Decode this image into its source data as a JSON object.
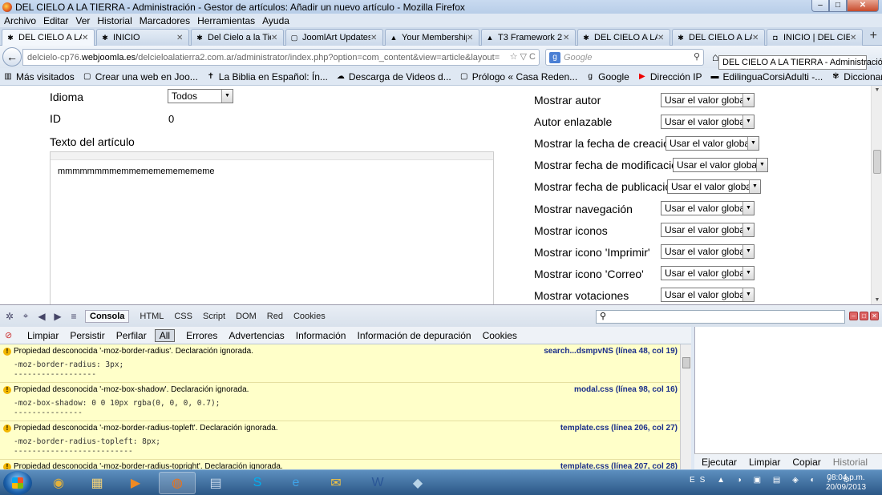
{
  "window": {
    "title": "DEL CIELO A LA TIERRA - Administración - Gestor de artículos: Añadir un nuevo artículo - Mozilla Firefox",
    "min": "–",
    "max": "□",
    "close": "✕"
  },
  "menu": [
    "Archivo",
    "Editar",
    "Ver",
    "Historial",
    "Marcadores",
    "Herramientas",
    "Ayuda"
  ],
  "tabs": [
    {
      "label": "DEL CIELO A LA TI...",
      "icon": "joomla-icon",
      "glyph": "✱",
      "active": true
    },
    {
      "label": "INICIO",
      "icon": "joomla-icon",
      "glyph": "✱",
      "active": false
    },
    {
      "label": "Del Cielo a la Tierr...",
      "icon": "joomla-icon",
      "glyph": "✱",
      "active": false
    },
    {
      "label": "JoomlArt Updates...",
      "icon": "page-icon",
      "glyph": "▢",
      "active": false
    },
    {
      "label": "Your Membership...",
      "icon": "joomlart-icon",
      "glyph": "▲",
      "active": false
    },
    {
      "label": "T3 Framework 2 f...",
      "icon": "joomlart-icon",
      "glyph": "▲",
      "active": false
    },
    {
      "label": "DEL CIELO A LA TI...",
      "icon": "joomla-icon",
      "glyph": "✱",
      "active": false
    },
    {
      "label": "DEL CIELO A LA TI...",
      "icon": "joomla-icon",
      "glyph": "✱",
      "active": false
    },
    {
      "label": "INICIO | DEL CIEL...",
      "icon": "site-icon",
      "glyph": "◘",
      "active": false
    }
  ],
  "tab_close": "✕",
  "new_tab": "+",
  "nav": {
    "back": "←",
    "url_prefix": "delcielo-cp76.",
    "url_domain": "webjoomla.es",
    "url_rest": "/delcieloalatierra2.com.ar/administrator/index.php?option=com_content&view=article&layout=",
    "url_icons": "☆ ▽ C",
    "search_engine": "g",
    "search_placeholder": "Google",
    "search_icon": "⚲",
    "home_icon": "⌂"
  },
  "tooltip": "DEL CIELO A LA TIERRA - Administración",
  "bookmarks": [
    {
      "label": "Más visitados",
      "icon": "bookmarks-icon",
      "glyph": "▥"
    },
    {
      "label": "Crear una web en Joo...",
      "icon": "page-icon",
      "glyph": "▢"
    },
    {
      "label": "La Biblia en Español: Ín...",
      "icon": "bible-icon",
      "glyph": "✝"
    },
    {
      "label": "Descarga de Videos d...",
      "icon": "download-icon",
      "glyph": "☁"
    },
    {
      "label": "Prólogo « Casa Reden...",
      "icon": "page-icon",
      "glyph": "▢"
    },
    {
      "label": "Google",
      "icon": "google-icon",
      "glyph": "g"
    },
    {
      "label": "Dirección IP",
      "icon": "youtube-icon",
      "glyph": "▶"
    },
    {
      "label": "EdilinguaCorsiAdulti -...",
      "icon": "page-icon",
      "glyph": "▬"
    },
    {
      "label": "Diccionario de la leng...",
      "icon": "dictionary-icon",
      "glyph": "✾"
    }
  ],
  "form_left": {
    "idioma_label": "Idioma",
    "idioma_value": "Todos",
    "id_label": "ID",
    "id_value": "0",
    "texto_label": "Texto del artículo",
    "editor_text": "mmmmmmmmemmememememememe"
  },
  "form_right": [
    {
      "label": "Mostrar autor",
      "value": "Usar el valor global"
    },
    {
      "label": "Autor enlazable",
      "value": "Usar el valor global"
    },
    {
      "label": "Mostrar la fecha de creación",
      "value": "Usar el valor global"
    },
    {
      "label": "Mostrar fecha de modificación",
      "value": "Usar el valor global"
    },
    {
      "label": "Mostrar fecha de publicación",
      "value": "Usar el valor global"
    },
    {
      "label": "Mostrar navegación",
      "value": "Usar el valor global"
    },
    {
      "label": "Mostrar iconos",
      "value": "Usar el valor global"
    },
    {
      "label": "Mostrar icono 'Imprimir'",
      "value": "Usar el valor global"
    },
    {
      "label": "Mostrar icono 'Correo'",
      "value": "Usar el valor global"
    },
    {
      "label": "Mostrar votaciones",
      "value": "Usar el valor global"
    }
  ],
  "select_arrow": "▼",
  "firebug": {
    "panel": "Consola",
    "panel_tabs": [
      "HTML",
      "CSS",
      "Script",
      "DOM",
      "Red",
      "Cookies"
    ],
    "filters": [
      "Limpiar",
      "Persistir",
      "Perfilar"
    ],
    "all": "All",
    "levels": [
      "Errores",
      "Advertencias",
      "Información",
      "Información de depuración",
      "Cookies"
    ],
    "search_placeholder": "⚲",
    "warn_glyph": "!",
    "logs": [
      {
        "msg": "Propiedad desconocida '-moz-border-radius'. Declaración ignorada.",
        "src": "search...dsmpvNS (línea 48, col 19)",
        "code": "-moz-border-radius: 3px;",
        "dashes": "------------------"
      },
      {
        "msg": "Propiedad desconocida '-moz-box-shadow'. Declaración ignorada.",
        "src": "modal.css (línea 98, col 16)",
        "code": "-moz-box-shadow: 0 0 10px rgba(0, 0, 0, 0.7);",
        "dashes": "---------------"
      },
      {
        "msg": "Propiedad desconocida '-moz-border-radius-topleft'. Declaración ignorada.",
        "src": "template.css (línea 206, col 27)",
        "code": "-moz-border-radius-topleft: 8px;",
        "dashes": "--------------------------"
      },
      {
        "msg": "Propiedad desconocida '-moz-border-radius-topright'. Declaración ignorada.",
        "src": "template.css (línea 207, col 28)",
        "code": "",
        "dashes": ""
      }
    ],
    "right_actions": [
      "Ejecutar",
      "Limpiar",
      "Copiar"
    ],
    "right_disabled": "Historial"
  },
  "taskbar": {
    "lang": "ES",
    "tray_icons": "▲ ◑ ▣ ▤ ◈ ◐ ♪ ⚙",
    "time": "08:04 p.m.",
    "date": "20/09/2013",
    "apps": [
      {
        "name": "chrome-app",
        "glyph": "◉",
        "color": "#e2b13c",
        "open": false
      },
      {
        "name": "explorer-app",
        "glyph": "▦",
        "color": "#f2d27a",
        "open": false
      },
      {
        "name": "media-player-app",
        "glyph": "▶",
        "color": "#f08a24",
        "open": false
      },
      {
        "name": "firefox-app",
        "glyph": "◍",
        "color": "#e8731c",
        "open": true
      },
      {
        "name": "calculator-app",
        "glyph": "▤",
        "color": "#c8d8ea",
        "open": false
      },
      {
        "name": "skype-app",
        "glyph": "S",
        "color": "#00aff0",
        "open": false
      },
      {
        "name": "ie-app",
        "glyph": "e",
        "color": "#3fa3e8",
        "open": false
      },
      {
        "name": "mail-app",
        "glyph": "✉",
        "color": "#f5c542",
        "open": false
      },
      {
        "name": "word-app",
        "glyph": "W",
        "color": "#2b5797",
        "open": false
      },
      {
        "name": "tool-app",
        "glyph": "◆",
        "color": "#b8d4e8",
        "open": false
      }
    ]
  }
}
